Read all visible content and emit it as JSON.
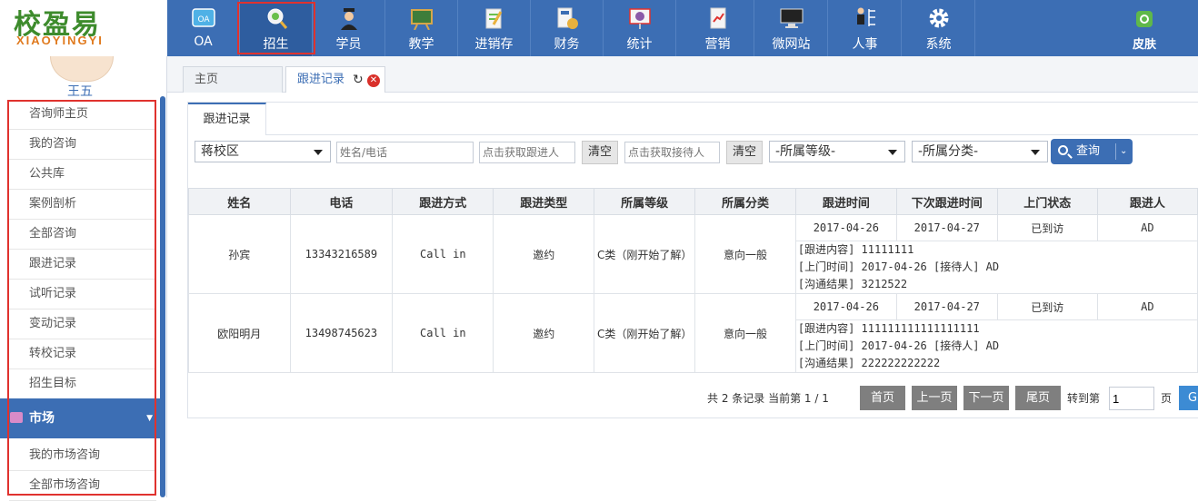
{
  "logo": {
    "cn": "校盈易",
    "en": "XIAOYINGYI"
  },
  "nav": [
    {
      "label": "OA",
      "icon": "oa-icon"
    },
    {
      "label": "招生",
      "icon": "enroll-icon"
    },
    {
      "label": "学员",
      "icon": "student-icon"
    },
    {
      "label": "教学",
      "icon": "teaching-icon"
    },
    {
      "label": "进销存",
      "icon": "inventory-icon"
    },
    {
      "label": "财务",
      "icon": "finance-icon"
    },
    {
      "label": "统计",
      "icon": "statistics-icon"
    },
    {
      "label": "营销",
      "icon": "marketing-icon"
    },
    {
      "label": "微网站",
      "icon": "website-icon"
    },
    {
      "label": "人事",
      "icon": "personnel-icon"
    },
    {
      "label": "系统",
      "icon": "gear-icon"
    }
  ],
  "skin_label": "皮肤",
  "colors": {
    "primary": "#3c6eb4",
    "highlight": "#e0322e",
    "close": "#d9302a"
  },
  "sidebar": {
    "username": "王五",
    "items": [
      "咨询师主页",
      "我的咨询",
      "公共库",
      "案例剖析",
      "全部咨询",
      "跟进记录",
      "试听记录",
      "变动记录",
      "转校记录",
      "招生目标"
    ],
    "section": "市场",
    "section_items": [
      "我的市场咨询",
      "全部市场咨询"
    ]
  },
  "tabs": {
    "home": "主页",
    "current": "跟进记录"
  },
  "panel_tab": "跟进记录",
  "filters": {
    "campus": "蒋校区",
    "name_placeholder": "姓名/电话",
    "follower_placeholder": "点击获取跟进人",
    "clear1": "清空",
    "receiver_placeholder": "点击获取接待人",
    "clear2": "清空",
    "level": "-所属等级-",
    "category": "-所属分类-",
    "query": "查询"
  },
  "table": {
    "headers": [
      "姓名",
      "电话",
      "跟进方式",
      "跟进类型",
      "所属等级",
      "所属分类",
      "跟进时间",
      "下次跟进时间",
      "上门状态",
      "跟进人"
    ],
    "rows": [
      {
        "name": "孙宾",
        "phone": "13343216589",
        "method": "Call in",
        "type": "邀约",
        "level": "C类（刚开始了解）",
        "category": "意向一般",
        "time": "2017-04-26",
        "next": "2017-04-27",
        "visit": "已到访",
        "follower": "AD",
        "content": "[跟进内容] 11111111",
        "visit_line": "[上门时间] 2017-04-26 [接待人] AD",
        "result": "[沟通结果] 3212522"
      },
      {
        "name": "欧阳明月",
        "phone": "13498745623",
        "method": "Call in",
        "type": "邀约",
        "level": "C类（刚开始了解）",
        "category": "意向一般",
        "time": "2017-04-26",
        "next": "2017-04-27",
        "visit": "已到访",
        "follower": "AD",
        "content": "[跟进内容] 111111111111111111",
        "visit_line": "[上门时间] 2017-04-26 [接待人] AD",
        "result": "[沟通结果] 222222222222"
      }
    ]
  },
  "pager": {
    "summary": "共 2 条记录 当前第 1 / 1",
    "first": "首页",
    "prev": "上一页",
    "next": "下一页",
    "last": "尾页",
    "goto": "转到第",
    "page_value": "1",
    "page_unit": "页",
    "go": "G"
  }
}
